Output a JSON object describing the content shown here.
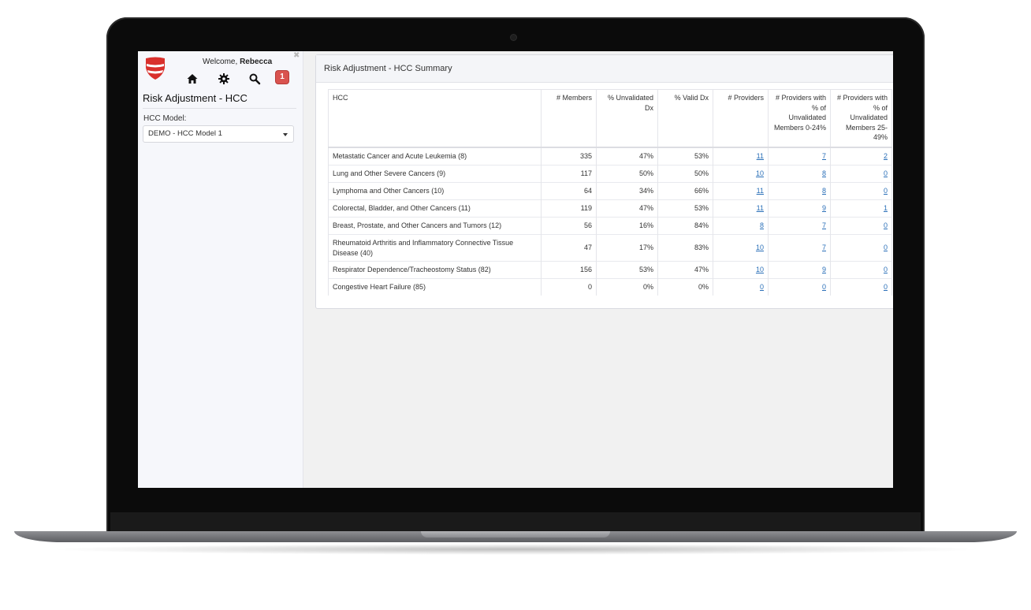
{
  "user": {
    "welcome_prefix": "Welcome,",
    "name": "Rebecca"
  },
  "notifications": {
    "count": "1"
  },
  "sidebar": {
    "title": "Risk Adjustment - HCC",
    "model_label": "HCC Model:",
    "model_selected": "DEMO - HCC Model 1"
  },
  "card": {
    "title": "Risk Adjustment - HCC Summary"
  },
  "table": {
    "headers": [
      "HCC",
      "# Members",
      "% Unvalidated Dx",
      "% Valid Dx",
      "# Providers",
      "# Providers with % of Unvalidated Members 0-24%",
      "# Providers with % of Unvalidated Members 25-49%"
    ],
    "rows": [
      [
        "Metastatic Cancer and Acute Leukemia (8)",
        "335",
        "47%",
        "53%",
        "11",
        "7",
        "2"
      ],
      [
        "Lung and Other Severe Cancers (9)",
        "117",
        "50%",
        "50%",
        "10",
        "8",
        "0"
      ],
      [
        "Lymphoma and Other Cancers (10)",
        "64",
        "34%",
        "66%",
        "11",
        "8",
        "0"
      ],
      [
        "Colorectal, Bladder, and Other Cancers (11)",
        "119",
        "47%",
        "53%",
        "11",
        "9",
        "1"
      ],
      [
        "Breast, Prostate, and Other Cancers and Tumors (12)",
        "56",
        "16%",
        "84%",
        "8",
        "7",
        "0"
      ],
      [
        "Rheumatoid Arthritis and Inflammatory Connective Tissue Disease (40)",
        "47",
        "17%",
        "83%",
        "10",
        "7",
        "0"
      ],
      [
        "Respirator Dependence/Tracheostomy Status (82)",
        "156",
        "53%",
        "47%",
        "10",
        "9",
        "0"
      ],
      [
        "Congestive Heart Failure (85)",
        "0",
        "0%",
        "0%",
        "0",
        "0",
        "0"
      ]
    ]
  },
  "colors": {
    "brand_red": "#d9302c",
    "link_blue": "#2a6fb8",
    "badge_red": "#d9534f"
  },
  "icons": [
    "logo-shield-icon",
    "home-icon",
    "gear-icon",
    "search-icon",
    "close-icon",
    "caret-down-icon"
  ]
}
